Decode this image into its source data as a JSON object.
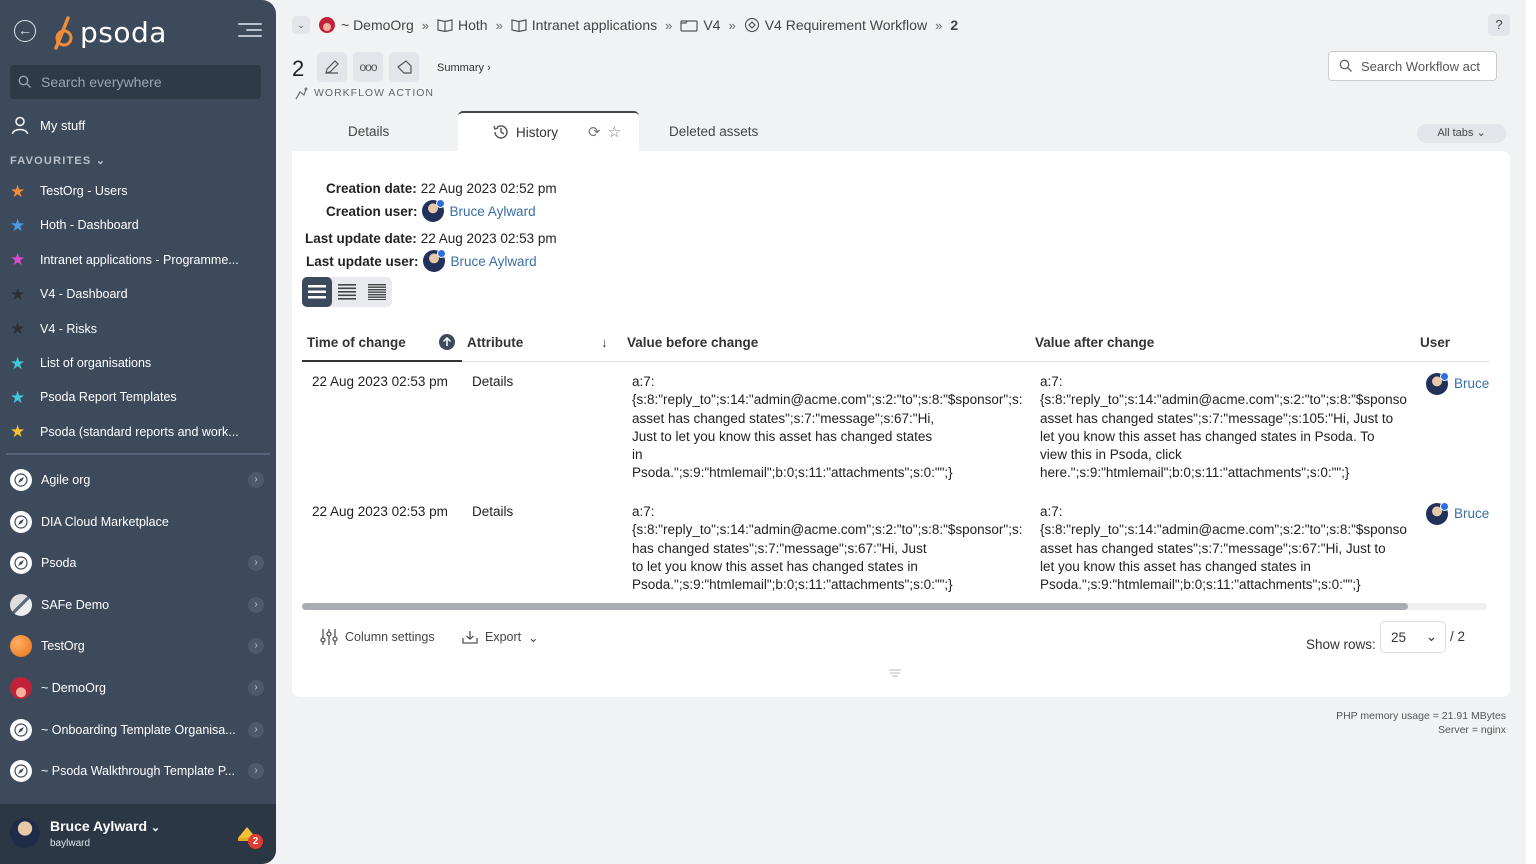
{
  "sidebar": {
    "logo": "psoda",
    "search_placeholder": "Search everywhere",
    "my_stuff": "My stuff",
    "favourites_title": "FAVOURITES",
    "favourites": [
      {
        "label": "TestOrg - Users",
        "color": "#f28c38"
      },
      {
        "label": "Hoth - Dashboard",
        "color": "#4a9be8"
      },
      {
        "label": "Intranet applications - Programme...",
        "color": "#d94fd0"
      },
      {
        "label": "V4 - Dashboard",
        "color": "#2a2f38"
      },
      {
        "label": "V4 - Risks",
        "color": "#2a2f38"
      },
      {
        "label": "List of organisations",
        "color": "#3ec8d8"
      },
      {
        "label": "Psoda Report Templates",
        "color": "#3ec8d8"
      },
      {
        "label": "Psoda (standard reports and work...",
        "color": "#f5c033"
      }
    ],
    "orgs": [
      {
        "label": "Agile org",
        "chevron": true,
        "icon": "compass-icon"
      },
      {
        "label": "DIA Cloud Marketplace",
        "chevron": false,
        "icon": "compass-icon"
      },
      {
        "label": "Psoda",
        "chevron": true,
        "icon": "compass-icon"
      },
      {
        "label": "SAFe Demo",
        "chevron": true,
        "icon": "safe-logo-icon"
      },
      {
        "label": "TestOrg",
        "chevron": true,
        "icon": "orange-globe-icon"
      },
      {
        "label": "~ DemoOrg",
        "chevron": true,
        "icon": "sunset-icon"
      },
      {
        "label": "~ Onboarding Template Organisa...",
        "chevron": true,
        "icon": "compass-icon"
      },
      {
        "label": "~ Psoda Walkthrough Template P...",
        "chevron": true,
        "icon": "compass-icon"
      }
    ],
    "user": {
      "name": "Bruce Aylward",
      "login": "baylward",
      "notifications": "2"
    }
  },
  "breadcrumb": [
    {
      "label": "~ DemoOrg",
      "icon": "org-icon"
    },
    {
      "label": "Hoth",
      "icon": "programme-icon"
    },
    {
      "label": "Intranet applications",
      "icon": "programme-icon"
    },
    {
      "label": "V4",
      "icon": "project-icon"
    },
    {
      "label": "V4 Requirement Workflow",
      "icon": "workflow-icon"
    },
    {
      "label": "2",
      "icon": ""
    }
  ],
  "help": "?",
  "record": {
    "number": "2",
    "summary_link": "Summary ›",
    "type_label": "WORKFLOW ACTION"
  },
  "search": {
    "placeholder": "Search Workflow act"
  },
  "tabs": {
    "details": "Details",
    "history": "History",
    "deleted": "Deleted assets",
    "all_tabs": "All tabs"
  },
  "meta": {
    "creation_date_label": "Creation date:",
    "creation_date": "22 Aug 2023 02:52 pm",
    "creation_user_label": "Creation user:",
    "creation_user": "Bruce Aylward",
    "update_date_label": "Last update date:",
    "update_date": "22 Aug 2023 02:53 pm",
    "update_user_label": "Last update user:",
    "update_user": "Bruce Aylward"
  },
  "table": {
    "headers": {
      "time": "Time of change",
      "attribute": "Attribute",
      "before": "Value before change",
      "after": "Value after change",
      "user": "User"
    },
    "rows": [
      {
        "time": "22 Aug 2023 02:53 pm",
        "attribute": "Details",
        "before": [
          "a:7:",
          "{s:8:\"reply_to\";s:14:\"admin@acme.com\";s:2:\"to\";s:8:\"$sponsor\";s:",
          "asset has changed states\";s:7:\"message\";s:67:\"Hi,",
          "Just to let you know this asset has changed states",
          "in",
          "Psoda.\";s:9:\"htmlemail\";b:0;s:11:\"attachments\";s:0:\"\";}"
        ],
        "after": [
          "a:7:",
          "{s:8:\"reply_to\";s:14:\"admin@acme.com\";s:2:\"to\";s:8:\"$sponso",
          "asset has changed states\";s:7:\"message\";s:105:\"Hi, Just to",
          "let you know this asset has changed states in Psoda. To",
          "view this in Psoda, click",
          "here.\";s:9:\"htmlemail\";b:0;s:11:\"attachments\";s:0:\"\";}"
        ],
        "user": "Bruce"
      },
      {
        "time": "22 Aug 2023 02:53 pm",
        "attribute": "Details",
        "before": [
          "a:7:",
          "{s:8:\"reply_to\";s:14:\"admin@acme.com\";s:2:\"to\";s:8:\"$sponsor\";s:",
          "has changed states\";s:7:\"message\";s:67:\"Hi, Just",
          "to let you know this asset has changed states in",
          "Psoda.\";s:9:\"htmlemail\";b:0;s:11:\"attachments\";s:0:\"\";}"
        ],
        "after": [
          "a:7:",
          "{s:8:\"reply_to\";s:14:\"admin@acme.com\";s:2:\"to\";s:8:\"$sponso",
          "asset has changed states\";s:7:\"message\";s:67:\"Hi, Just to",
          "let you know this asset has changed states in",
          "Psoda.\";s:9:\"htmlemail\";b:0;s:11:\"attachments\";s:0:\"\";}"
        ],
        "user": "Bruce"
      }
    ]
  },
  "footer": {
    "column_settings": "Column settings",
    "export": "Export",
    "show_rows_label": "Show rows:",
    "rows_value": "25",
    "pages": "/ 2"
  },
  "server": {
    "memory": "PHP memory usage = 21.91 MBytes",
    "server": "Server = nginx"
  }
}
